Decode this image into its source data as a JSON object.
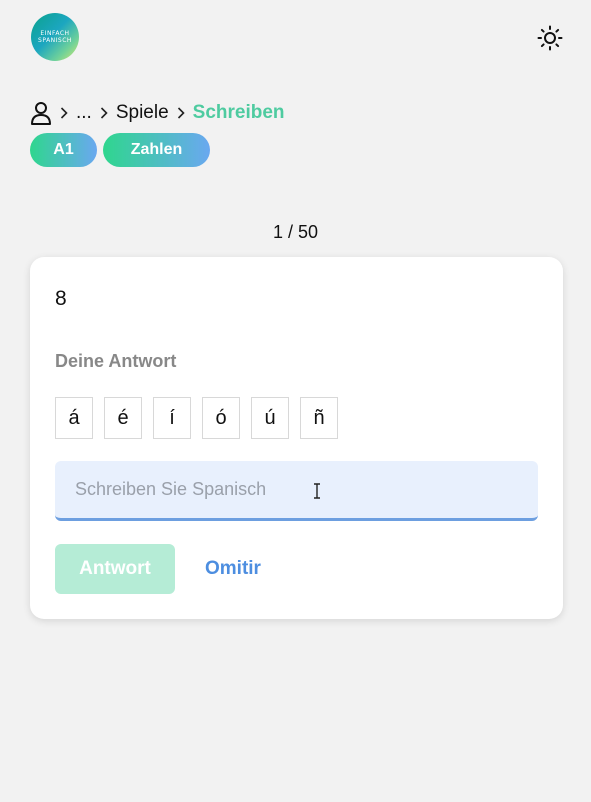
{
  "logo": {
    "line1": "EINFACH",
    "line2": "SPANISCH"
  },
  "breadcrumb": {
    "ellipsis": "...",
    "parent": "Spiele",
    "current": "Schreiben"
  },
  "tags": {
    "level": "A1",
    "topic": "Zahlen"
  },
  "progress": "1 / 50",
  "card": {
    "prompt": "8",
    "answer_label": "Deine Antwort",
    "accents": [
      "á",
      "é",
      "í",
      "ó",
      "ú",
      "ñ"
    ],
    "input": {
      "value": "",
      "placeholder": "Schreiben Sie Spanisch"
    },
    "submit_label": "Antwort",
    "skip_label": "Omitir"
  },
  "colors": {
    "accent_green": "#4ecba0",
    "accent_blue": "#4d8ee0",
    "input_bg": "#e8f0fd",
    "submit_disabled": "#b5ecd6"
  }
}
